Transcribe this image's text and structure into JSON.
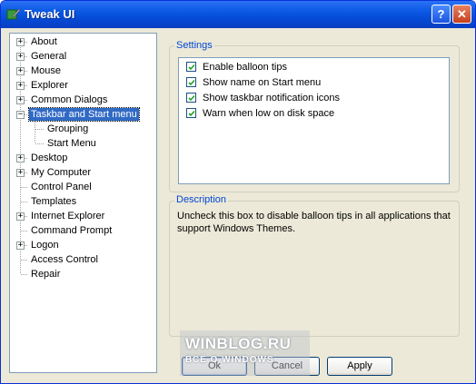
{
  "window": {
    "title": "Tweak UI",
    "help_glyph": "?",
    "close_glyph": "✕"
  },
  "tree": {
    "items": [
      {
        "label": "About",
        "expander": "+"
      },
      {
        "label": "General",
        "expander": "+"
      },
      {
        "label": "Mouse",
        "expander": "+"
      },
      {
        "label": "Explorer",
        "expander": "+"
      },
      {
        "label": "Common Dialogs",
        "expander": "+"
      },
      {
        "label": "Taskbar and Start menu",
        "expander": "−",
        "selected": true
      },
      {
        "label": "Grouping",
        "child": true
      },
      {
        "label": "Start Menu",
        "child": true
      },
      {
        "label": "Desktop",
        "expander": "+"
      },
      {
        "label": "My Computer",
        "expander": "+"
      },
      {
        "label": "Control Panel"
      },
      {
        "label": "Templates"
      },
      {
        "label": "Internet Explorer",
        "expander": "+"
      },
      {
        "label": "Command Prompt"
      },
      {
        "label": "Logon",
        "expander": "+"
      },
      {
        "label": "Access Control"
      },
      {
        "label": "Repair"
      }
    ]
  },
  "settings": {
    "title": "Settings",
    "options": [
      {
        "label": "Enable balloon tips",
        "checked": true
      },
      {
        "label": "Show name on Start menu",
        "checked": true
      },
      {
        "label": "Show taskbar notification icons",
        "checked": true
      },
      {
        "label": "Warn when low on disk space",
        "checked": true
      }
    ]
  },
  "description": {
    "title": "Description",
    "text": "Uncheck this box to disable balloon tips in all applications that support Windows Themes."
  },
  "buttons": {
    "ok": "Ok",
    "cancel": "Cancel",
    "apply": "Apply"
  },
  "watermark": {
    "title": "WINBLOG.RU",
    "subtitle": "ВСЁ О WINDOWS"
  }
}
